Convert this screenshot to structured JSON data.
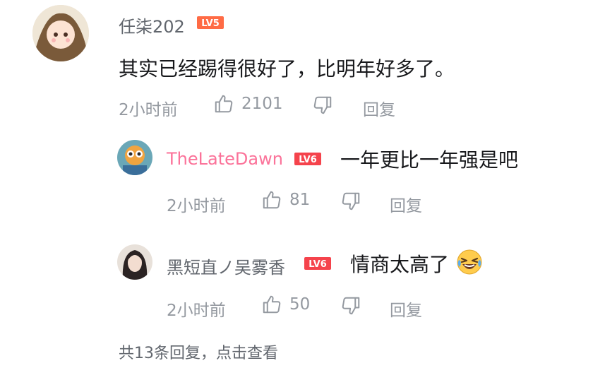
{
  "comment": {
    "username": "任柒202",
    "level": "LV5",
    "text": "其实已经踢得很好了，比明年好多了。",
    "time": "2小时前",
    "likes": "2101",
    "reply_label": "回复"
  },
  "replies": [
    {
      "username": "TheLateDawn",
      "level": "LV6",
      "text": "一年更比一年强是吧",
      "time": "2小时前",
      "likes": "81",
      "reply_label": "回复"
    },
    {
      "username": "黑短直ノ吴雾香",
      "level": "LV6",
      "text": "情商太高了",
      "emoji": "laughing-crying-emoji",
      "time": "2小时前",
      "likes": "50",
      "reply_label": "回复"
    }
  ],
  "more_replies": "共13条回复，点击查看",
  "colors": {
    "level5": "#ff6b45",
    "level6": "#f5434c",
    "vip_name": "#fb7299",
    "meta": "#9499a0"
  },
  "icons": [
    "like-icon",
    "dislike-icon"
  ]
}
